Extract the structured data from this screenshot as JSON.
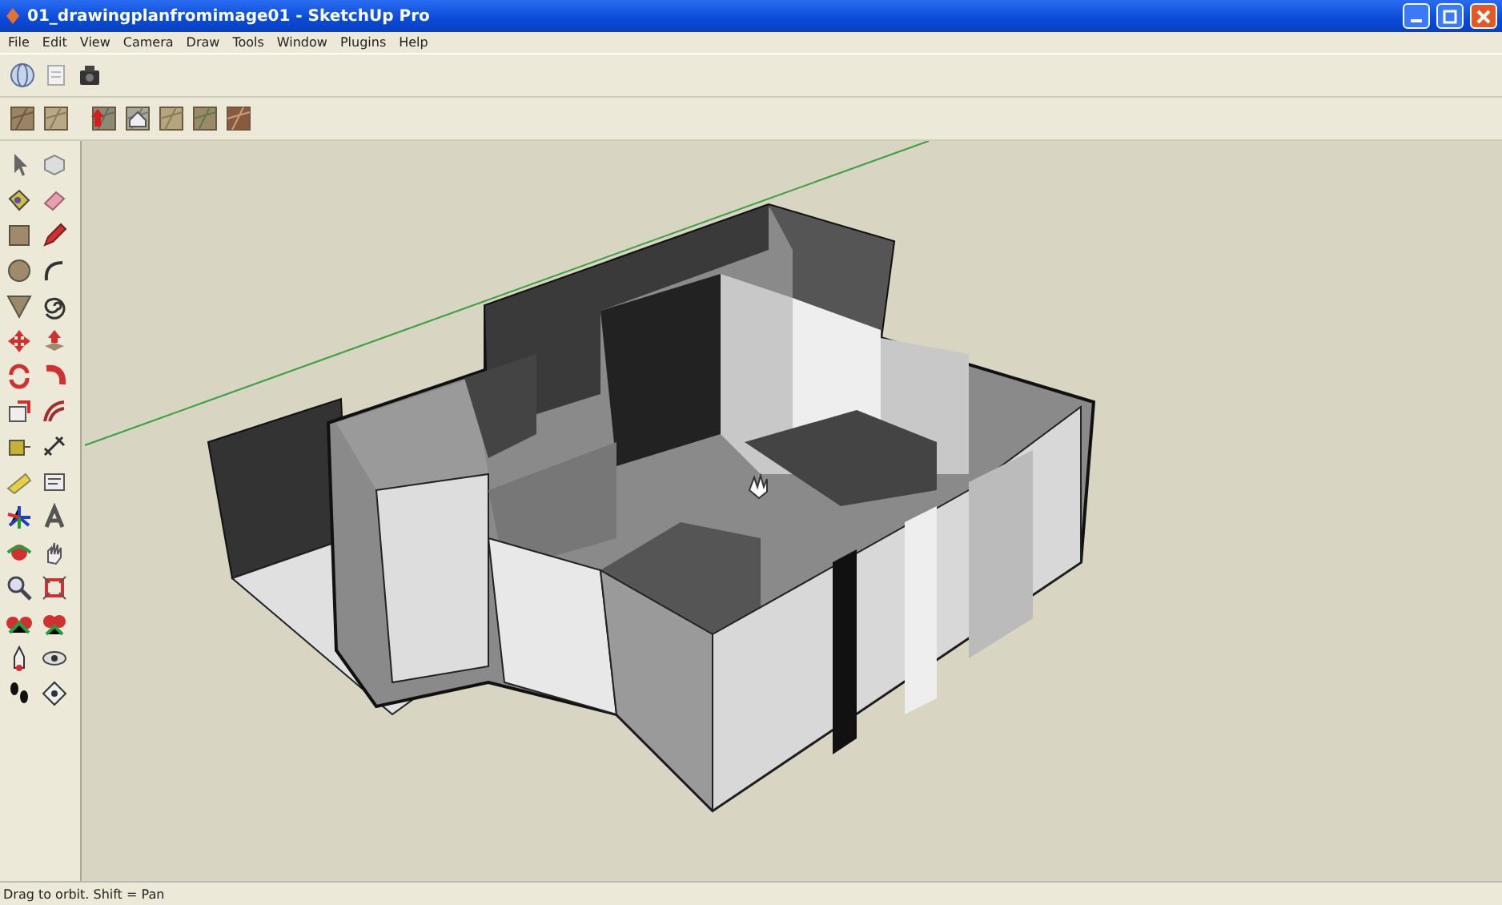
{
  "window": {
    "title": "01_drawingplanfromimage01 - SketchUp Pro"
  },
  "menu": [
    "File",
    "Edit",
    "View",
    "Camera",
    "Draw",
    "Tools",
    "Window",
    "Plugins",
    "Help"
  ],
  "status_bar": {
    "text": "Drag to orbit.  Shift = Pan"
  }
}
